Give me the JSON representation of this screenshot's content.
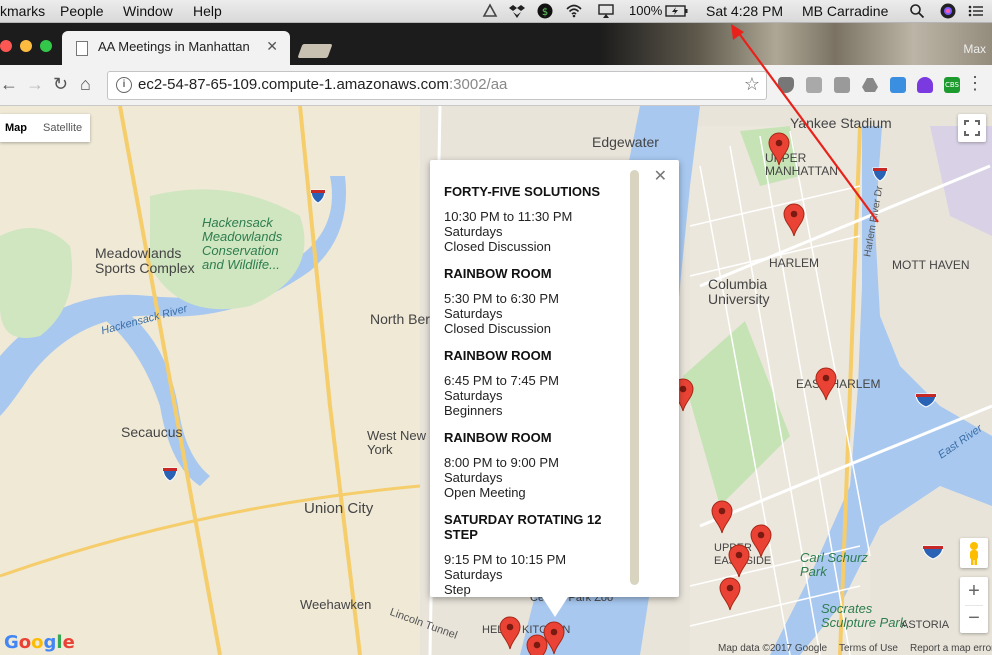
{
  "menubar": {
    "items": [
      "kmarks",
      "People",
      "Window",
      "Help"
    ],
    "battery": "100%",
    "clock": "Sat 4:28 PM",
    "user": "MB Carradine"
  },
  "browser": {
    "tab_title": "AA Meetings in Manhattan",
    "window_label": "Max",
    "url_host": "ec2-54-87-65-109.compute-1.amazonaws.com",
    "url_rest": ":3002/aa"
  },
  "map": {
    "map_type_options": [
      "Map",
      "Satellite"
    ],
    "labels": {
      "edgewater": "Edgewater",
      "yankee_stadium": "Yankee Stadium",
      "upper_manhattan": "UPPER\nMANHATTAN",
      "harlem": "HARLEM",
      "columbia": "Columbia\nUniversity",
      "mott_haven": "MOTT HAVEN",
      "east_harlem": "EAST HARLEM",
      "meadowlands": "Meadowlands\nSports Complex",
      "hackensack": "Hackensack\nMeadowlands\nConservation\nand Wildlife...",
      "hackensack_river": "Hackensack River",
      "north_bergen": "North Bergen",
      "secaucus": "Secaucus",
      "west_new_york": "West New\nYork",
      "union_city": "Union City",
      "weehawken": "Weehawken",
      "lincoln_tunnel": "Lincoln Tunnel",
      "carl_schurz": "Carl Schurz\nPark",
      "socrates": "Socrates\nSculpture Park",
      "astoria": "ASTORIA",
      "upper_east_side": "UPPER\nEAST SIDE",
      "central_park_zoo": "Central Park Zoo",
      "hells_kitchen": "HELL'S KITCHEN",
      "east_river": "East River",
      "harlem_river": "Harlem River Dr"
    },
    "footer": {
      "google": "Google",
      "map_data": "Map data ©2017 Google",
      "terms": "Terms of Use",
      "report": "Report a map error"
    }
  },
  "infowindow": {
    "meetings": [
      {
        "name": "FORTY-FIVE SOLUTIONS",
        "time": "10:30 PM to 11:30 PM",
        "day": "Saturdays",
        "type": "Closed Discussion"
      },
      {
        "name": "RAINBOW ROOM",
        "time": "5:30 PM to 6:30 PM",
        "day": "Saturdays",
        "type": "Closed Discussion"
      },
      {
        "name": "RAINBOW ROOM",
        "time": "6:45 PM to 7:45 PM",
        "day": "Saturdays",
        "type": "Beginners"
      },
      {
        "name": "RAINBOW ROOM",
        "time": "8:00 PM to 9:00 PM",
        "day": "Saturdays",
        "type": "Open Meeting"
      },
      {
        "name": "SATURDAY ROTATING 12 STEP",
        "time": "9:15 PM to 10:15 PM",
        "day": "Saturdays",
        "type": "Step"
      }
    ]
  }
}
